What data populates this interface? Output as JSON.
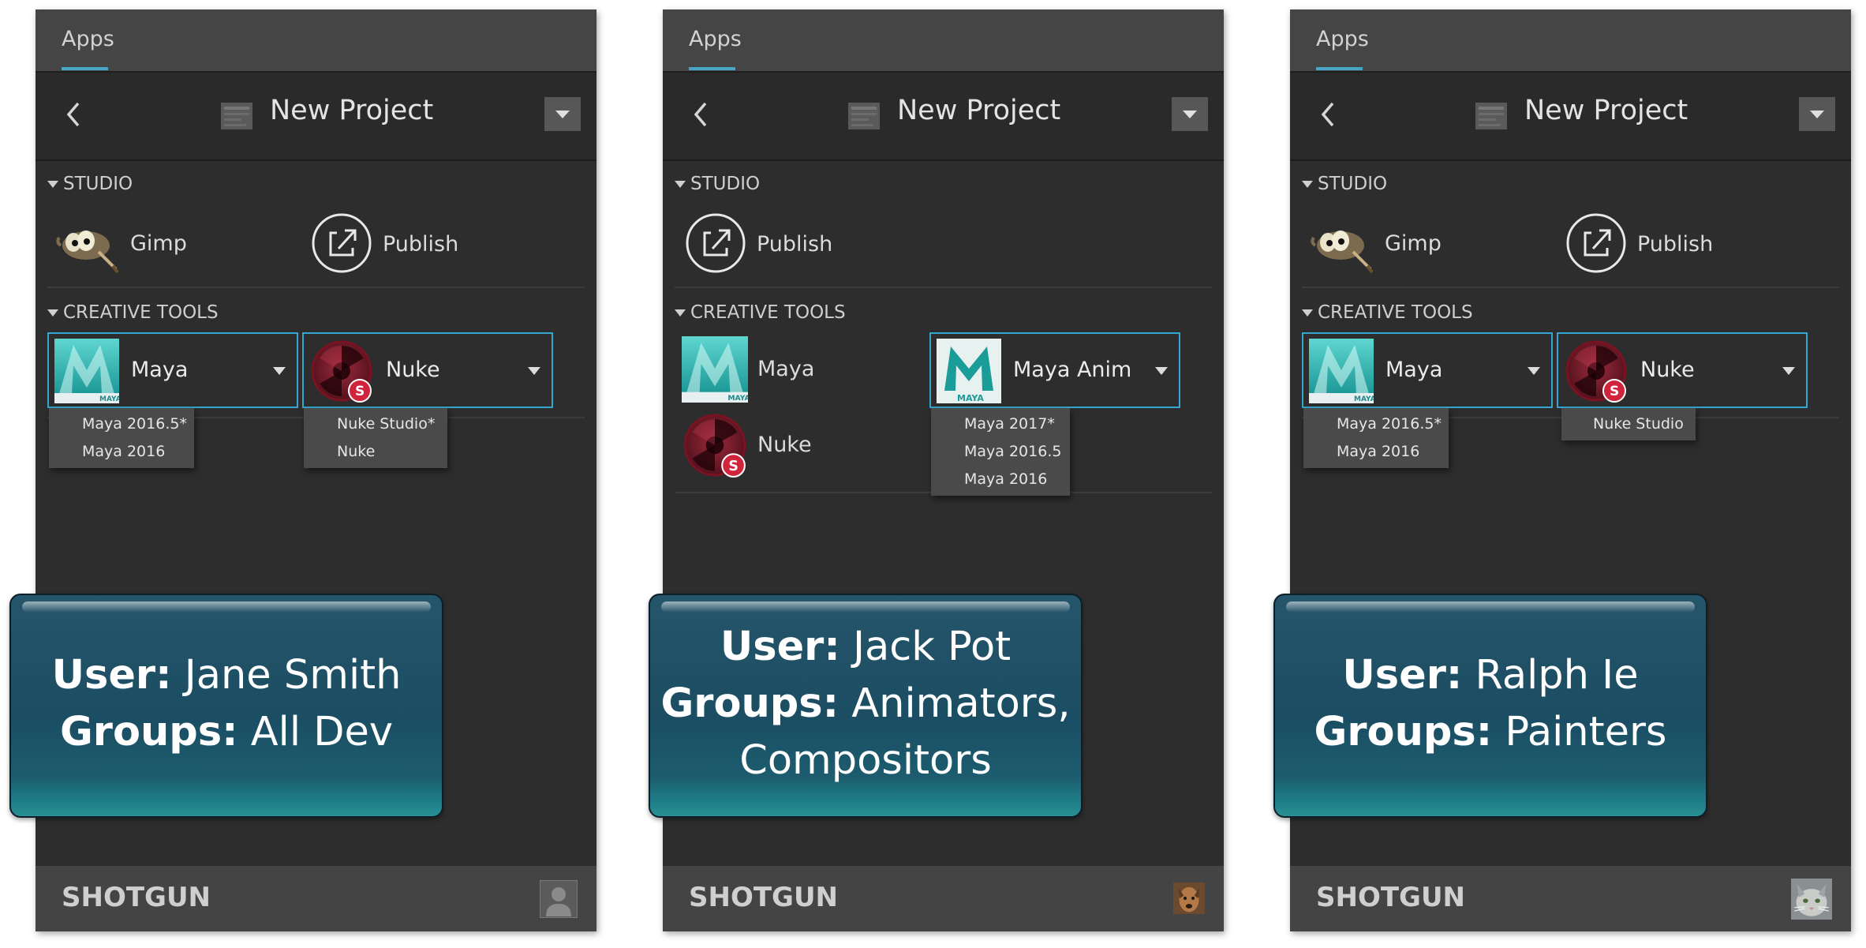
{
  "common": {
    "tab_label": "Apps",
    "project_title": "New Project",
    "section_studio": "STUDIO",
    "section_creative": "CREATIVE TOOLS",
    "logo_text": "SHOTGUN",
    "user_prefix": "User:",
    "groups_prefix": "Groups:"
  },
  "colors": {
    "panel_bg": "#2d2d2d",
    "tab_bar": "#454545",
    "accent": "#35a6cf",
    "callout": "#1b4d63"
  },
  "panels": [
    {
      "studio": [
        "Gimp",
        "Publish"
      ],
      "creative": {
        "maya_label": "Maya",
        "maya_menu": [
          "Maya 2016.5*",
          "Maya 2016"
        ],
        "nuke_label": "Nuke",
        "nuke_menu": [
          "Nuke Studio*",
          "Nuke"
        ]
      },
      "user": "Jane Smith",
      "groups": "All Dev",
      "avatar": "default-user-icon"
    },
    {
      "studio": [
        "Publish"
      ],
      "creative": {
        "maya_label": "Maya",
        "maya_anim_label": "Maya Anim",
        "maya_anim_menu": [
          "Maya 2017*",
          "Maya 2016.5",
          "Maya 2016"
        ],
        "nuke_label": "Nuke"
      },
      "user": "Jack Pot",
      "groups_line1": "Animators,",
      "groups_line2": "Compositors",
      "avatar": "dog-photo-avatar"
    },
    {
      "studio": [
        "Gimp",
        "Publish"
      ],
      "creative": {
        "maya_label": "Maya",
        "maya_menu": [
          "Maya 2016.5*",
          "Maya 2016"
        ],
        "nuke_label": "Nuke",
        "nuke_menu": [
          "Nuke Studio"
        ]
      },
      "user": "Ralph Ie",
      "groups": "Painters",
      "avatar": "cat-photo-avatar"
    }
  ]
}
